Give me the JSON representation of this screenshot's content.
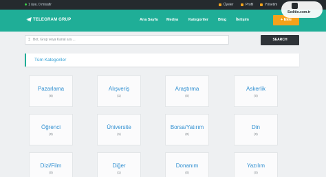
{
  "topbar": {
    "online_text": "1 üye, 0 misafir",
    "links": [
      {
        "label": "Üyeler",
        "icon": "users-icon"
      },
      {
        "label": "Profil",
        "icon": "user-icon"
      },
      {
        "label": "Yönetim",
        "icon": "wrench-icon"
      }
    ]
  },
  "nav": {
    "brand": "TELEGRAM GRUP",
    "links": [
      "Ana Sayfa",
      "Medya",
      "Kategoriler",
      "Blog",
      "İletişim"
    ],
    "add_button": "+ Ekle"
  },
  "search": {
    "placeholder": "Bot, Grup veya Kanal ara ...",
    "button": "SEARCH"
  },
  "section": {
    "title": "Tüm Kategoriler"
  },
  "categories": [
    {
      "name": "Pazarlama",
      "count": "(8)"
    },
    {
      "name": "Alışveriş",
      "count": "(1)"
    },
    {
      "name": "Araştırma",
      "count": "(0)"
    },
    {
      "name": "Askerlik",
      "count": "(0)"
    },
    {
      "name": "Öğrenci",
      "count": "(0)"
    },
    {
      "name": "Üniversite",
      "count": "(1)"
    },
    {
      "name": "Borsa/Yatırım",
      "count": "(0)"
    },
    {
      "name": "Din",
      "count": "(0)"
    },
    {
      "name": "Dizi/Film",
      "count": "(0)"
    },
    {
      "name": "Diğer",
      "count": "(1)"
    },
    {
      "name": "Donanım",
      "count": "(0)"
    },
    {
      "name": "Yazılım",
      "count": "(0)"
    }
  ],
  "watermark": {
    "text": "Seditio.com.tr"
  },
  "colors": {
    "nav_bg": "#1fae97",
    "accent_orange": "#f5a21b",
    "link_blue": "#2f8fd1",
    "topbar_bg": "#252a2e"
  }
}
